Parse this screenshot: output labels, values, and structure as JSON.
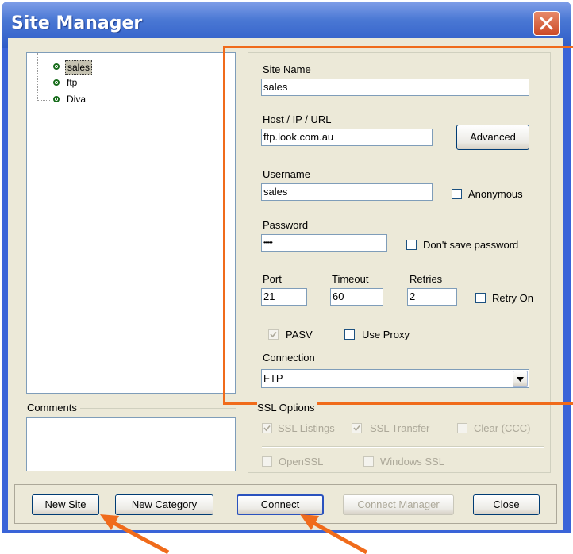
{
  "window": {
    "title": "Site Manager"
  },
  "tree": {
    "items": [
      "sales",
      "ftp",
      "Diva"
    ]
  },
  "comments": {
    "label": "Comments",
    "value": ""
  },
  "form": {
    "site_name": {
      "label": "Site Name",
      "value": "sales"
    },
    "host": {
      "label": "Host / IP / URL",
      "value": "ftp.look.com.au"
    },
    "advanced": {
      "label": "Advanced"
    },
    "username": {
      "label": "Username",
      "value": "sales"
    },
    "anonymous": {
      "label": "Anonymous",
      "checked": false
    },
    "password": {
      "label": "Password",
      "value": "••••••"
    },
    "dont_save": {
      "label": "Don't save password",
      "checked": false
    },
    "port": {
      "label": "Port",
      "value": "21"
    },
    "timeout": {
      "label": "Timeout",
      "value": "60"
    },
    "retries": {
      "label": "Retries",
      "value": "2"
    },
    "retry_on": {
      "label": "Retry On",
      "checked": false
    },
    "pasv": {
      "label": "PASV",
      "checked": true
    },
    "use_proxy": {
      "label": "Use Proxy",
      "checked": false
    },
    "connection": {
      "label": "Connection",
      "value": "FTP"
    }
  },
  "ssl": {
    "label": "SSL Options",
    "listings": "SSL Listings",
    "transfer": "SSL Transfer",
    "clear": "Clear (CCC)",
    "openssl": "OpenSSL",
    "windows_ssl": "Windows SSL"
  },
  "buttons": {
    "new_site": "New Site",
    "new_category": "New Category",
    "connect": "Connect",
    "connect_manager": "Connect Manager",
    "close": "Close"
  },
  "colors": {
    "titlebar": "#2f5cc8",
    "highlight": "#f06b1b",
    "face": "#ece9d8"
  }
}
